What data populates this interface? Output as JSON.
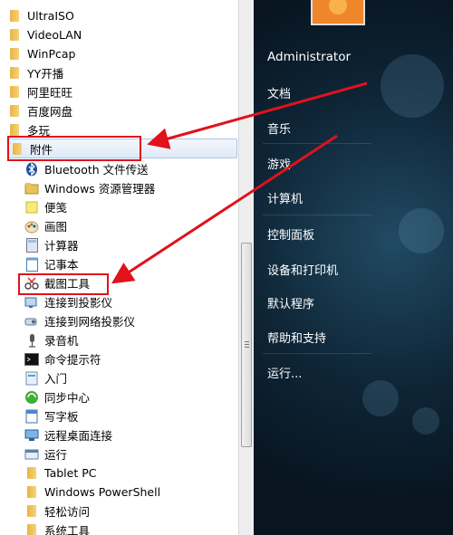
{
  "programs": {
    "folders_top": [
      {
        "label": "UltraISO"
      },
      {
        "label": "VideoLAN"
      },
      {
        "label": "WinPcap"
      },
      {
        "label": "YY开播"
      },
      {
        "label": "阿里旺旺"
      },
      {
        "label": "百度网盘"
      },
      {
        "label": "多玩"
      }
    ],
    "accessories": {
      "label": "附件"
    },
    "accessory_items": [
      {
        "label": "Bluetooth 文件传送",
        "icon": "bluetooth-icon"
      },
      {
        "label": "Windows 资源管理器",
        "icon": "folder-explorer-icon"
      },
      {
        "label": "便笺",
        "icon": "sticky-note-icon"
      },
      {
        "label": "画图",
        "icon": "paint-icon"
      },
      {
        "label": "计算器",
        "icon": "calculator-icon"
      },
      {
        "label": "记事本",
        "icon": "notepad-icon"
      },
      {
        "label": "截图工具",
        "icon": "snipping-tool-icon"
      },
      {
        "label": "连接到投影仪",
        "icon": "projector-icon"
      },
      {
        "label": "连接到网络投影仪",
        "icon": "network-projector-icon"
      },
      {
        "label": "录音机",
        "icon": "microphone-icon"
      },
      {
        "label": "命令提示符",
        "icon": "cmd-icon"
      },
      {
        "label": "入门",
        "icon": "getting-started-icon"
      },
      {
        "label": "同步中心",
        "icon": "sync-icon"
      },
      {
        "label": "写字板",
        "icon": "wordpad-icon"
      },
      {
        "label": "远程桌面连接",
        "icon": "remote-desktop-icon"
      },
      {
        "label": "运行",
        "icon": "run-icon"
      }
    ],
    "subfolders": [
      {
        "label": "Tablet PC"
      },
      {
        "label": "Windows PowerShell"
      },
      {
        "label": "轻松访问"
      },
      {
        "label": "系统工具"
      }
    ]
  },
  "right_panel": {
    "user": "Administrator",
    "items": [
      {
        "label": "文档"
      },
      {
        "label": "音乐"
      },
      {
        "label": "游戏"
      },
      {
        "label": "计算机"
      },
      {
        "label": "控制面板"
      },
      {
        "label": "设备和打印机"
      },
      {
        "label": "默认程序"
      },
      {
        "label": "帮助和支持"
      },
      {
        "label": "运行..."
      }
    ]
  },
  "colors": {
    "highlight_red": "#e0121b",
    "folder": "#e8b545",
    "selection_border": "#a8c6ea"
  }
}
